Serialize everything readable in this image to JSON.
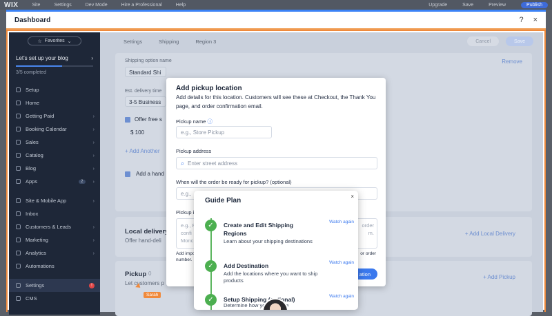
{
  "topbar": {
    "logo": "WIX",
    "items": [
      "Site",
      "Settings",
      "Dev Mode",
      "Hire a Professional",
      "Help"
    ],
    "right": [
      "Upgrade",
      "Save",
      "Preview",
      "Publish"
    ]
  },
  "dashboard": {
    "title": "Dashboard",
    "help": "?",
    "close": "×"
  },
  "sidebar": {
    "favorites": "Favorites",
    "setup_title": "Let's set up your blog",
    "completed": "3/5 completed",
    "items": [
      {
        "label": "Setup",
        "icon": "setup-icon"
      },
      {
        "label": "Home",
        "icon": "home-icon"
      },
      {
        "label": "Getting Paid",
        "icon": "dollar-icon",
        "chev": "›"
      },
      {
        "label": "Booking Calendar",
        "icon": "calendar-icon",
        "chev": "›"
      },
      {
        "label": "Sales",
        "icon": "sales-icon",
        "chev": "›"
      },
      {
        "label": "Catalog",
        "icon": "catalog-icon",
        "chev": "›"
      },
      {
        "label": "Blog",
        "icon": "blog-icon",
        "chev": "›"
      },
      {
        "label": "Apps",
        "icon": "apps-icon",
        "badge": "2",
        "chev": "›"
      }
    ],
    "items2": [
      {
        "label": "Site & Mobile App",
        "icon": "site-icon",
        "chev": "›"
      },
      {
        "label": "Inbox",
        "icon": "inbox-icon"
      },
      {
        "label": "Customers & Leads",
        "icon": "customers-icon",
        "chev": "›"
      },
      {
        "label": "Marketing",
        "icon": "marketing-icon",
        "chev": "›"
      },
      {
        "label": "Analytics",
        "icon": "analytics-icon",
        "chev": "›"
      },
      {
        "label": "Automations",
        "icon": "automations-icon"
      }
    ],
    "settings": {
      "label": "Settings",
      "dot": "!"
    },
    "cms": "CMS"
  },
  "breadcrumb": [
    "Settings",
    "Shipping",
    "Region 3"
  ],
  "actions": {
    "cancel": "Cancel",
    "save": "Save"
  },
  "background": {
    "shipping_label": "Shipping option name",
    "shipping_value": "Standard Shi",
    "remove": "Remove",
    "delivery_label": "Est. delivery time",
    "delivery_value": "3-5 Business",
    "offer_free": "Offer free s",
    "price": "$ 100",
    "add_another": "+ Add Another",
    "add_hand": "Add a hand",
    "local_title": "Local delivery",
    "local_sub": "Offer hand-deli",
    "add_local": "+ Add Local Delivery",
    "pickup_title": "Pickup",
    "pickup_count": "0",
    "pickup_sub": "Let customers p",
    "add_pickup": "+ Add Pickup"
  },
  "modal": {
    "title": "Add pickup location",
    "subtitle": "Add details for this location. Customers will see these at Checkout, the Thank You page, and order confirmation email.",
    "name_label": "Pickup name",
    "name_placeholder": "e.g., Store Pickup",
    "address_label": "Pickup address",
    "address_placeholder": "Enter street address",
    "ready_label": "When will the order be ready for pickup? (optional)",
    "ready_placeholder": "e.g., ",
    "instr_label": "Pickup i",
    "instr_placeholder": "e.g., F",
    "instr_line2": "confi",
    "instr_line3": "Monc",
    "instr_right1": "order",
    "instr_right2": "m.",
    "note_left": "Add impo",
    "note_left2": "number.",
    "note_right": "or order",
    "save_btn": "ation"
  },
  "guide": {
    "title": "Guide Plan",
    "close": "×",
    "steps": [
      {
        "title": "Create and Edit Shipping Regions",
        "desc": "Learn about your shipping destinations",
        "action": "Watch again"
      },
      {
        "title": "Add Destination",
        "desc": "Add the locations where you want to ship products",
        "action": "Watch again"
      },
      {
        "title": "Setup Shipping (optional)",
        "desc": "Determine how you'll charge",
        "action": "Watch again"
      }
    ]
  },
  "cursor_label": "Sarah"
}
